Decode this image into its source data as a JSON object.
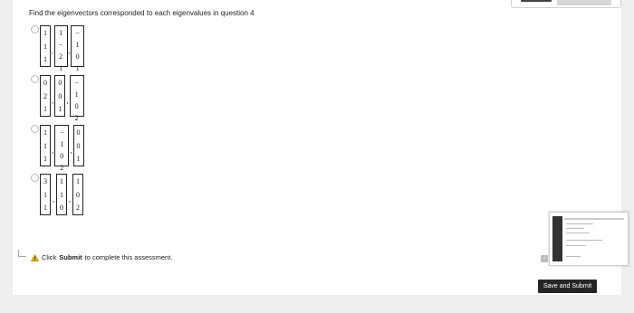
{
  "question": "Find the eigenvectors corresponded to each eigenvalues in question 4",
  "options": [
    {
      "vectors": [
        [
          "1",
          "1",
          "1"
        ],
        [
          "1",
          "− 2",
          "1"
        ],
        [
          "− 1",
          "0",
          "1"
        ]
      ]
    },
    {
      "vectors": [
        [
          "0",
          "2",
          "1"
        ],
        [
          "0",
          "0",
          "1"
        ],
        [
          "− 1",
          "0",
          "2"
        ]
      ]
    },
    {
      "vectors": [
        [
          "1",
          "1",
          "1"
        ],
        [
          "− 1",
          "0",
          "2"
        ],
        [
          "0",
          "0",
          "1"
        ]
      ]
    },
    {
      "vectors": [
        [
          "3",
          "1",
          "1"
        ],
        [
          "1",
          "1",
          "0"
        ],
        [
          "1",
          "0",
          "2"
        ]
      ]
    }
  ],
  "submit_hint": {
    "prefix": "Click",
    "bold": "Submit",
    "suffix": "to complete this assessment."
  },
  "save_button": "Save and Submit",
  "icons": {
    "warning": "warning-icon",
    "radio": "radio-button",
    "preview": "page-preview-thumbnail"
  },
  "colors": {
    "button_bg": "#262626",
    "warning": "#f0b400"
  }
}
